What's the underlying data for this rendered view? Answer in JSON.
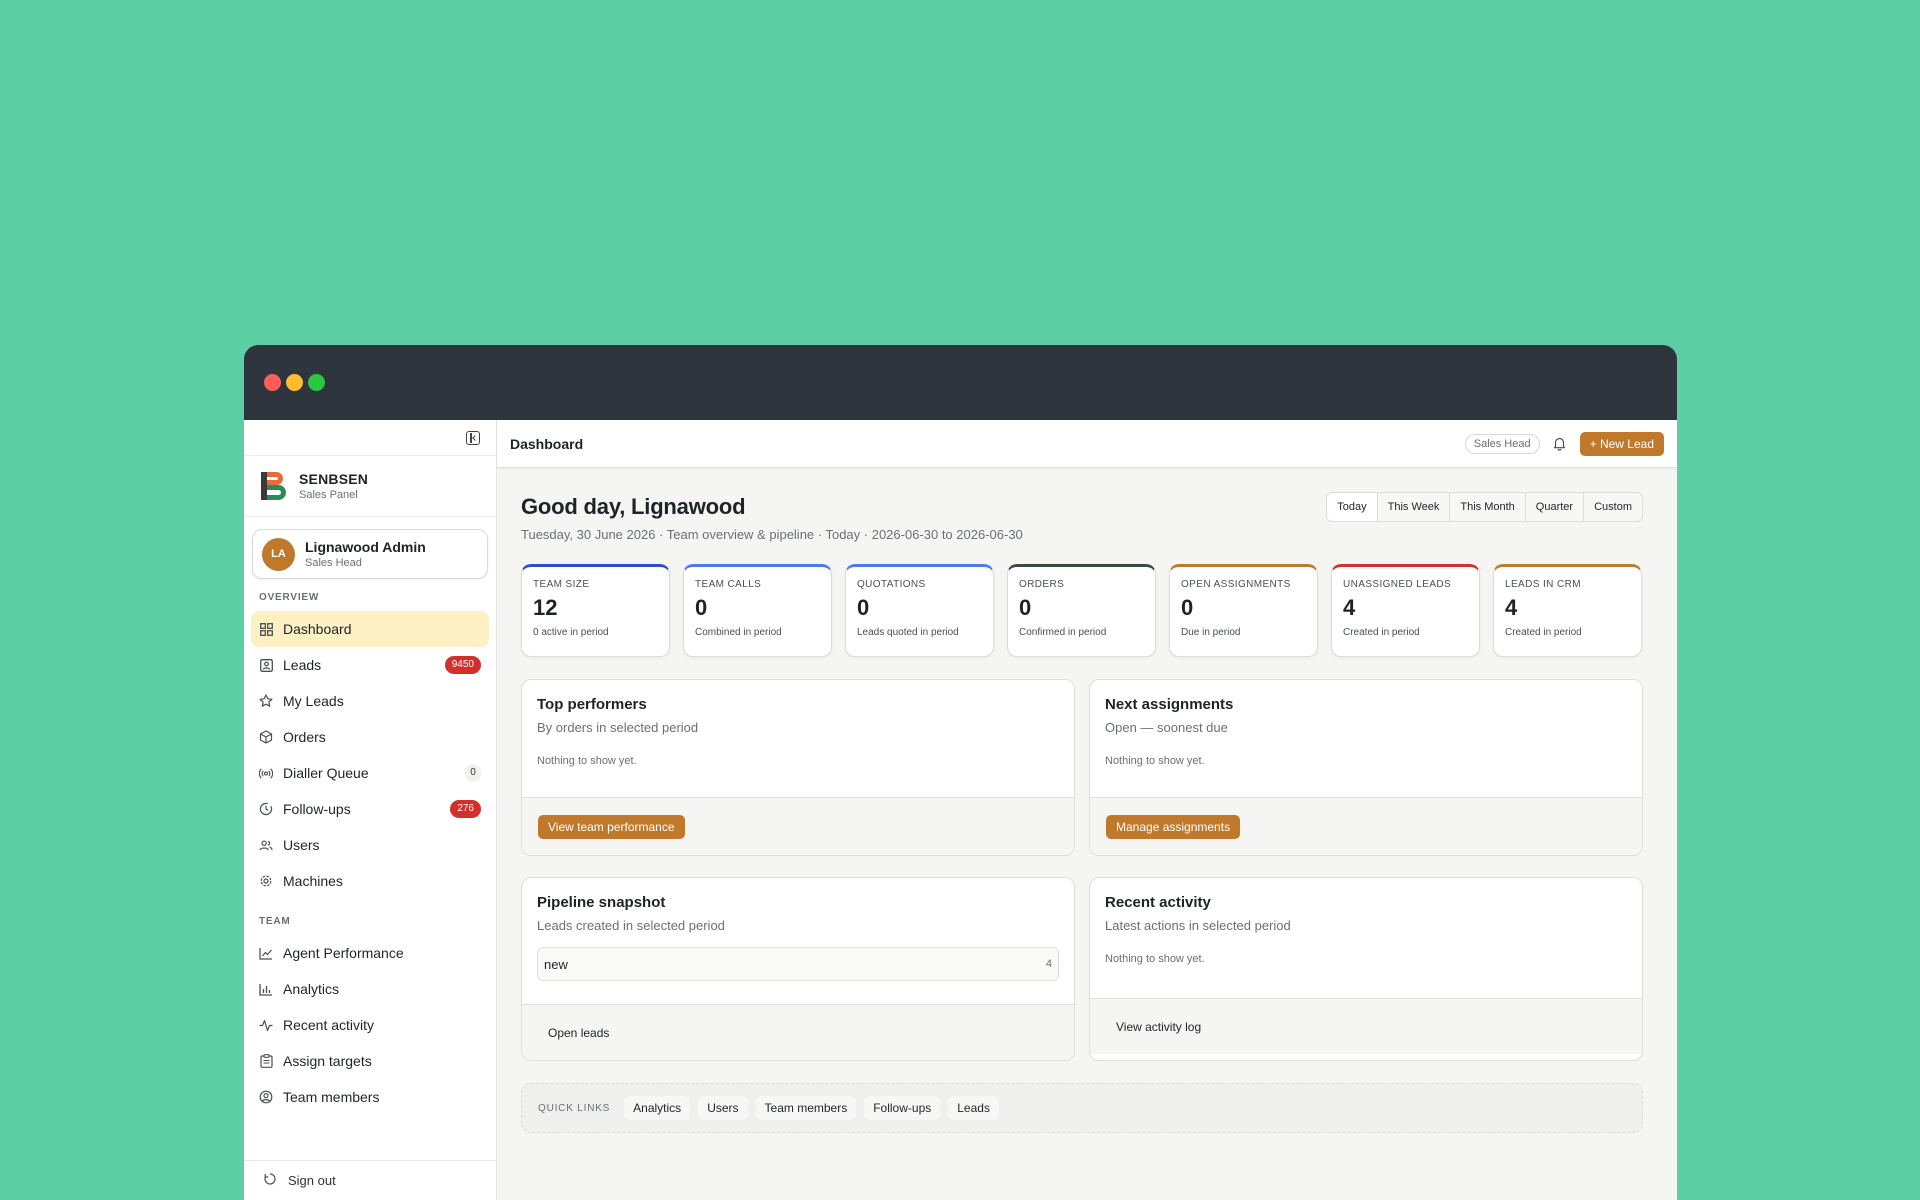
{
  "sidebar": {
    "brand": {
      "name": "SENBSEN",
      "sub": "Sales Panel"
    },
    "user": {
      "initials": "LA",
      "name": "Lignawood Admin",
      "role": "Sales Head"
    },
    "overview_label": "OVERVIEW",
    "overview_items": [
      {
        "label": "Dashboard",
        "icon": "grid-icon",
        "active": true
      },
      {
        "label": "Leads",
        "icon": "contact-card-icon",
        "badge": "9450"
      },
      {
        "label": "My Leads",
        "icon": "star-icon"
      },
      {
        "label": "Orders",
        "icon": "box-icon"
      },
      {
        "label": "Dialler Queue",
        "icon": "broadcast-icon",
        "badge": "0"
      },
      {
        "label": "Follow-ups",
        "icon": "clock-icon",
        "badge": "276"
      },
      {
        "label": "Users",
        "icon": "users-icon"
      },
      {
        "label": "Machines",
        "icon": "cog-icon"
      }
    ],
    "team_label": "TEAM",
    "team_items": [
      {
        "label": "Agent Performance",
        "icon": "line-chart-icon"
      },
      {
        "label": "Analytics",
        "icon": "bar-chart-icon"
      },
      {
        "label": "Recent activity",
        "icon": "pulse-icon"
      },
      {
        "label": "Assign targets",
        "icon": "clipboard-icon"
      },
      {
        "label": "Team members",
        "icon": "user-circle-icon"
      }
    ],
    "signout": "Sign out"
  },
  "topbar": {
    "title": "Dashboard",
    "role_pill": "Sales Head",
    "new_lead": "+ New Lead"
  },
  "header": {
    "greeting": "Good day, Lignawood",
    "subtitle": "Tuesday, 30 June 2026 · Team overview & pipeline · Today · 2026-06-30 to 2026-06-30",
    "periods": [
      "Today",
      "This Week",
      "This Month",
      "Quarter",
      "Custom"
    ]
  },
  "stats": [
    {
      "label": "TEAM SIZE",
      "value": "12",
      "sub": "0 active in period",
      "accent": "#2a4fd1"
    },
    {
      "label": "TEAM CALLS",
      "value": "0",
      "sub": "Combined in period",
      "accent": "#4a7de8"
    },
    {
      "label": "QUOTATIONS",
      "value": "0",
      "sub": "Leads quoted in period",
      "accent": "#4a7de8"
    },
    {
      "label": "ORDERS",
      "value": "0",
      "sub": "Confirmed in period",
      "accent": "#3d4a3f"
    },
    {
      "label": "OPEN ASSIGNMENTS",
      "value": "0",
      "sub": "Due in period",
      "accent": "#c0782a"
    },
    {
      "label": "UNASSIGNED LEADS",
      "value": "4",
      "sub": "Created in period",
      "accent": "#d2302a"
    },
    {
      "label": "LEADS IN CRM",
      "value": "4",
      "sub": "Created in period",
      "accent": "#c0782a"
    }
  ],
  "cards": {
    "top_performers": {
      "title": "Top performers",
      "sub": "By orders in selected period",
      "empty": "Nothing to show yet.",
      "action": "View team performance"
    },
    "next_assignments": {
      "title": "Next assignments",
      "sub": "Open — soonest due",
      "empty": "Nothing to show yet.",
      "action": "Manage assignments"
    },
    "pipeline": {
      "title": "Pipeline snapshot",
      "sub": "Leads created in selected period",
      "stages": [
        {
          "stage": "new",
          "count": "4"
        }
      ],
      "action": "Open leads"
    },
    "recent_activity": {
      "title": "Recent activity",
      "sub": "Latest actions in selected period",
      "empty": "Nothing to show yet.",
      "action": "View activity log"
    }
  },
  "quick_links": {
    "label": "QUICK LINKS",
    "items": [
      "Analytics",
      "Users",
      "Team members",
      "Follow-ups",
      "Leads"
    ]
  },
  "colors": {
    "accent": "#c0782a",
    "badge_red": "#d2302a",
    "active_nav": "#fdf0c4",
    "background": "#5ccfa5"
  }
}
